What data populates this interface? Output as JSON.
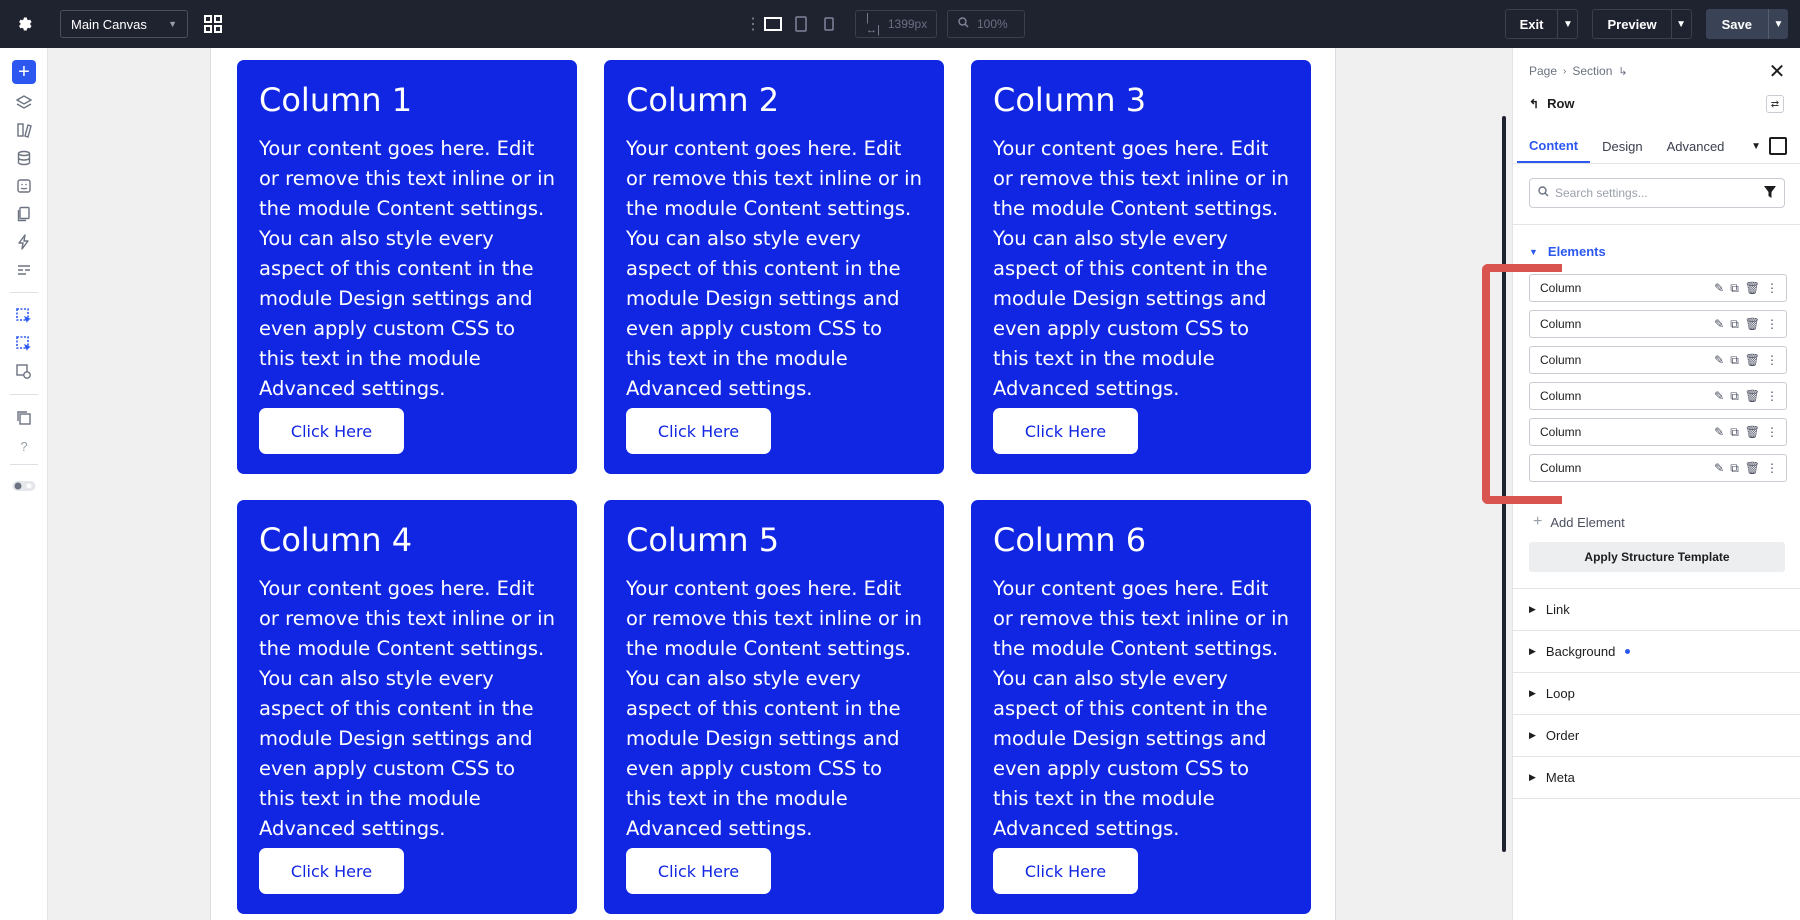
{
  "topbar": {
    "canvas_select": "Main Canvas",
    "width_value": "1399px",
    "zoom_value": "100%",
    "exit_label": "Exit",
    "preview_label": "Preview",
    "save_label": "Save"
  },
  "columns": [
    {
      "title": "Column 1",
      "body": "Your content goes here. Edit or remove this text inline or in the module Content settings. You can also style every aspect of this content in the module Design settings and even apply custom CSS to this text in the module Advanced settings.",
      "button": "Click Here"
    },
    {
      "title": "Column 2",
      "body": "Your content goes here. Edit or remove this text inline or in the module Content settings. You can also style every aspect of this content in the module Design settings and even apply custom CSS to this text in the module Advanced settings.",
      "button": "Click Here"
    },
    {
      "title": "Column 3",
      "body": "Your content goes here. Edit or remove this text inline or in the module Content settings. You can also style every aspect of this content in the module Design settings and even apply custom CSS to this text in the module Advanced settings.",
      "button": "Click Here"
    },
    {
      "title": "Column 4",
      "body": "Your content goes here. Edit or remove this text inline or in the module Content settings. You can also style every aspect of this content in the module Design settings and even apply custom CSS to this text in the module Advanced settings.",
      "button": "Click Here"
    },
    {
      "title": "Column 5",
      "body": "Your content goes here. Edit or remove this text inline or in the module Content settings. You can also style every aspect of this content in the module Design settings and even apply custom CSS to this text in the module Advanced settings.",
      "button": "Click Here"
    },
    {
      "title": "Column 6",
      "body": "Your content goes here. Edit or remove this text inline or in the module Content settings. You can also style every aspect of this content in the module Design settings and even apply custom CSS to this text in the module Advanced settings.",
      "button": "Click Here"
    }
  ],
  "panel": {
    "breadcrumb": [
      "Page",
      "Section"
    ],
    "element_title": "Row",
    "tabs": [
      "Content",
      "Design",
      "Advanced"
    ],
    "search_placeholder": "Search settings...",
    "elements_header": "Elements",
    "elements": [
      "Column",
      "Column",
      "Column",
      "Column",
      "Column",
      "Column"
    ],
    "add_element": "Add Element",
    "apply_template": "Apply Structure Template",
    "sections": [
      "Link",
      "Background",
      "Loop",
      "Order",
      "Meta"
    ]
  },
  "colors": {
    "accent": "#2c58f0",
    "card_blue": "#1126e3",
    "topbar": "#1f2330",
    "highlight_bracket": "#d9534f"
  }
}
